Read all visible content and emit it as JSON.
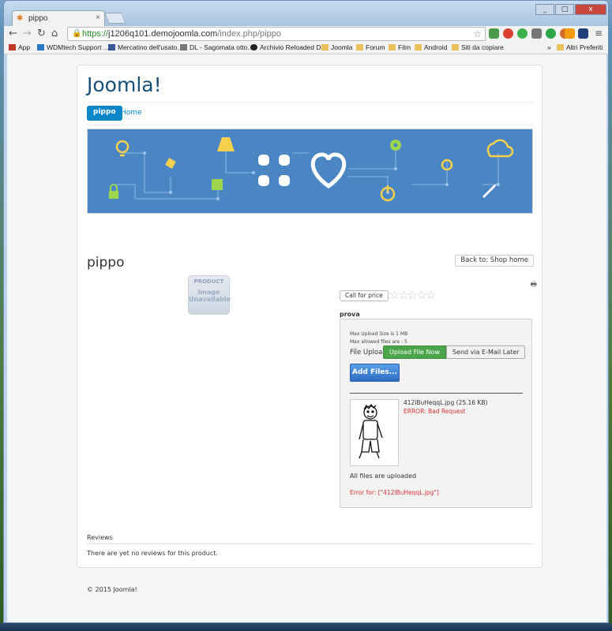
{
  "browser": {
    "tab_title": "pippo",
    "tab_close": "×",
    "url_scheme": "https://",
    "url_host": "j1206q101.demojoomla.com",
    "url_path": "/index.php/pippo",
    "window_controls": [
      "_",
      "□",
      "x"
    ],
    "bookmarks": [
      {
        "label": "App",
        "icon": "apps-icon"
      },
      {
        "label": "WDMtech Support ...",
        "icon": "dots-icon"
      },
      {
        "label": "Mercatino dell'usato...",
        "icon": "facebook-icon"
      },
      {
        "label": "DL - Sagomata otto...",
        "icon": "dl-icon"
      },
      {
        "label": "Archivio Reloaded D...",
        "icon": "reloaded-icon"
      },
      {
        "label": "Joomla",
        "icon": "folder-icon"
      },
      {
        "label": "Forum",
        "icon": "folder-icon"
      },
      {
        "label": "Film",
        "icon": "folder-icon"
      },
      {
        "label": "Android",
        "icon": "folder-icon"
      },
      {
        "label": "Siti da copiare",
        "icon": "folder-icon"
      }
    ],
    "more_bookmarks": "»",
    "other_bookmarks": "Altri Preferiti"
  },
  "site": {
    "brand": "Joomla!",
    "nav": {
      "active": "pippo",
      "home": "Home"
    },
    "footer": "© 2015 Joomla!"
  },
  "product": {
    "title": "pippo",
    "back_button": "Back to: Shop home",
    "no_image": {
      "line1": "PRODUCT",
      "line2": "Image",
      "line3": "Unavailable"
    },
    "call_for_price": "Call for price",
    "rating_stars": 5,
    "rating_value": 0
  },
  "upload": {
    "label": "prova",
    "max_size": "Max Upload Size is 1 MB",
    "max_files": "Max allowed files are : 5",
    "file_upload_label": "File Upload",
    "upload_now": "Upload File Now",
    "send_later": "Send via E-Mail Later",
    "add_files": "Add Files...",
    "file_name": "412iBuHeqqL.jpg (25.16 KB)",
    "file_error": "ERROR: Bad Request",
    "all_uploaded": "All files are uploaded",
    "error_for": "Error for: [\"412iBuHeqqL.jpg\"]"
  },
  "reviews": {
    "title": "Reviews",
    "empty": "There are yet no reviews for this product."
  },
  "colors": {
    "brand": "#14507a",
    "accent": "#0d87c8",
    "banner": "#4b86c4",
    "success": "#4aa54a",
    "error": "#dd3333"
  }
}
